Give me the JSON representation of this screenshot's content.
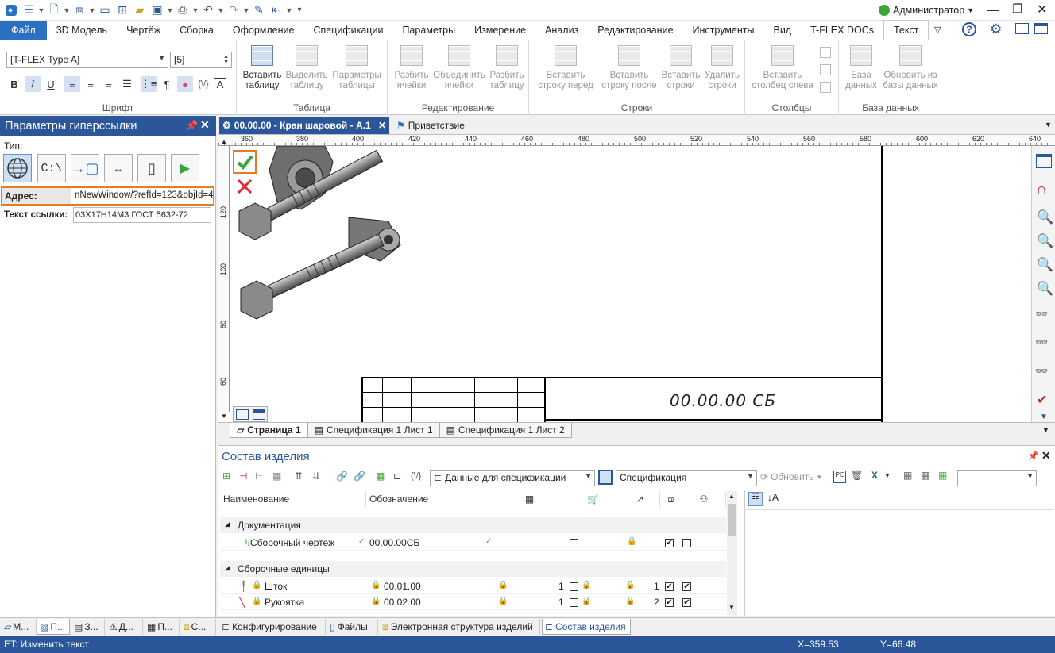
{
  "user": {
    "name": "Администратор"
  },
  "menu": {
    "tabs": [
      "Файл",
      "3D Модель",
      "Чертёж",
      "Сборка",
      "Оформление",
      "Спецификации",
      "Параметры",
      "Измерение",
      "Анализ",
      "Редактирование",
      "Инструменты",
      "Вид",
      "T-FLEX DOCs",
      "Текст"
    ],
    "active": "Текст"
  },
  "ribbon": {
    "font_name": "[T-FLEX Type A]",
    "font_size": "[5]",
    "format_buttons": [
      "B",
      "I",
      "U",
      "¶",
      "{\\/}"
    ],
    "groups": {
      "font": "Шрифт",
      "table": "Таблица",
      "edit": "Редактирование",
      "rows": "Строки",
      "cols": "Столбцы",
      "db": "База данных"
    },
    "buttons": {
      "insert_table": [
        "Вставить",
        "таблицу"
      ],
      "select_table": [
        "Выделить",
        "таблицу"
      ],
      "table_params": [
        "Параметры",
        "таблицы"
      ],
      "split_cells": [
        "Разбить",
        "ячейки"
      ],
      "merge_cells": [
        "Объединить",
        "ячейки"
      ],
      "split_table": [
        "Разбить",
        "таблицу"
      ],
      "row_before": [
        "Вставить",
        "строку перед"
      ],
      "row_after": [
        "Вставить",
        "строку после"
      ],
      "insert_rows": [
        "Вставить",
        "строки"
      ],
      "delete_rows": [
        "Удалить",
        "строки"
      ],
      "col_left": [
        "Вставить",
        "столбец слева"
      ],
      "db": [
        "База",
        "данных"
      ],
      "db_update": [
        "Обновить из",
        "базы данных"
      ]
    }
  },
  "left_panel": {
    "title": "Параметры гиперссылки",
    "type_label": "Тип:",
    "address_label": "Адрес:",
    "address_value": "nNewWindow/?refId=123&objId=4",
    "text_label": "Текст ссылки:",
    "text_value": "03Х17Н14М3 ГОСТ 5632-72",
    "type_path_glyph": "C:\\"
  },
  "doc_tabs": [
    "00.00.00 - Кран шаровой - А.1",
    "Приветствие"
  ],
  "ruler": {
    "marks": [
      "360",
      "380",
      "400",
      "420",
      "440",
      "460",
      "480",
      "500",
      "520",
      "540",
      "560",
      "580",
      "600",
      "620",
      "640"
    ],
    "vmarks": [
      "120",
      "100",
      "80",
      "60"
    ]
  },
  "drawing": {
    "designation": "00.00.00 СБ"
  },
  "sheet_tabs": [
    "Страница 1",
    "Спецификация 1 Лист 1",
    "Спецификация 1 Лист 2"
  ],
  "composition": {
    "title": "Состав изделия",
    "data_combo": "Данные для спецификации",
    "spec_combo": "Спецификация",
    "refresh": "Обновить",
    "fx": "{\\/}",
    "col_name": "Наименование",
    "col_designation": "Обозначение",
    "groups": [
      {
        "name": "Документация",
        "rows": [
          {
            "name": "Сборочный чертеж",
            "designation": "00.00.00СБ",
            "qty": "",
            "pos": ""
          }
        ]
      },
      {
        "name": "Сборочные единицы",
        "rows": [
          {
            "name": "Шток",
            "designation": "00.01.00",
            "qty": "1",
            "pos": "1"
          },
          {
            "name": "Рукоятка",
            "designation": "00.02.00",
            "qty": "1",
            "pos": "2"
          }
        ]
      }
    ]
  },
  "bottom_tabs": [
    "М...",
    "П...",
    "З...",
    "Д...",
    "П...",
    "С...",
    "Конфигурирование",
    "Файлы",
    "Электронная структура изделий",
    "Состав изделия"
  ],
  "status": {
    "message": "ET: Изменить текст",
    "x": "X=359.53",
    "y": "Y=66.48"
  }
}
